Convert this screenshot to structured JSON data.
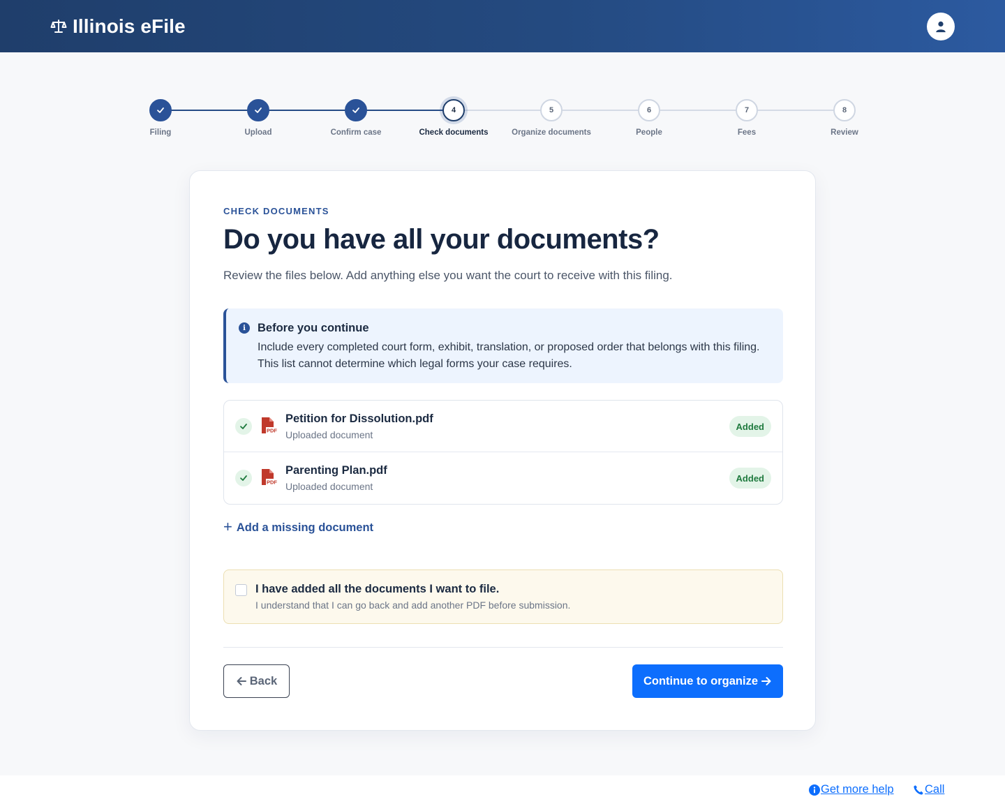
{
  "header": {
    "brand": "Illinois eFile",
    "brand_icon": "scales-icon",
    "account_icon": "user-icon"
  },
  "stepper": {
    "steps": [
      {
        "number": "1",
        "label": "Filing",
        "state": "done"
      },
      {
        "number": "2",
        "label": "Upload",
        "state": "done"
      },
      {
        "number": "3",
        "label": "Confirm case",
        "state": "done"
      },
      {
        "number": "4",
        "label": "Check documents",
        "state": "current"
      },
      {
        "number": "5",
        "label": "Organize documents",
        "state": "upcoming"
      },
      {
        "number": "6",
        "label": "People",
        "state": "upcoming"
      },
      {
        "number": "7",
        "label": "Fees",
        "state": "upcoming"
      },
      {
        "number": "8",
        "label": "Review",
        "state": "upcoming"
      }
    ]
  },
  "main": {
    "eyebrow": "CHECK DOCUMENTS",
    "title": "Do you have all your documents?",
    "subtitle": "Review the files below. Add anything else you want the court to receive with this filing.",
    "notice": {
      "title": "Before you continue",
      "body": "Include every completed court form, exhibit, translation, or proposed order that belongs with this filing. This list cannot determine which legal forms your case requires."
    },
    "documents": [
      {
        "name": "Petition for Dissolution.pdf",
        "subtitle": "Uploaded document",
        "status": "Added"
      },
      {
        "name": "Parenting Plan.pdf",
        "subtitle": "Uploaded document",
        "status": "Added"
      }
    ],
    "add_link": "Add a missing document",
    "confirm": {
      "title": "I have added all the documents I want to file.",
      "subtitle": "I understand that I can go back and add another PDF before submission.",
      "checked": false
    },
    "back_label": "Back",
    "continue_label": "Continue to organize"
  },
  "footer": {
    "help_label": "Get more help",
    "call_label": "Call"
  },
  "colors": {
    "header": "#244a80",
    "primary": "#2a5298",
    "button": "#0d6efd",
    "success": "#1f7a3e",
    "pdf": "#c0392b"
  }
}
